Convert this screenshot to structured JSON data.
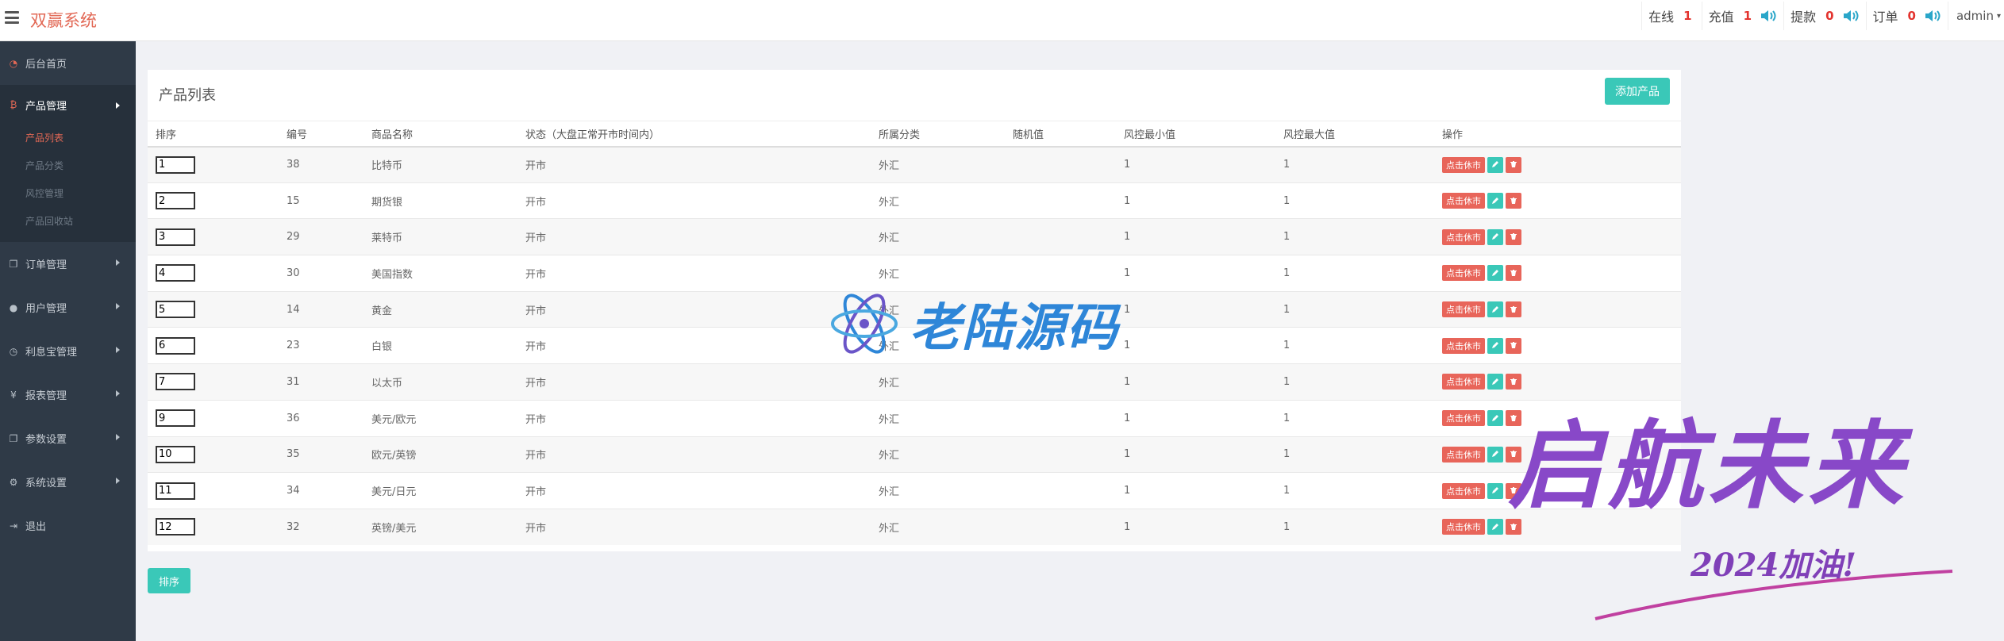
{
  "header": {
    "brand": "双赢系统",
    "online_label": "在线",
    "online_count": "1",
    "recharge_label": "充值",
    "recharge_count": "1",
    "withdraw_label": "提款",
    "withdraw_count": "0",
    "order_label": "订单",
    "order_count": "0",
    "user": "admin"
  },
  "sidebar": {
    "items": [
      {
        "label": "后台首页",
        "icon": "dashboard-icon"
      },
      {
        "label": "产品管理",
        "icon": "bitcoin-icon"
      },
      {
        "label": "订单管理",
        "icon": "copy-icon"
      },
      {
        "label": "用户管理",
        "icon": "user-icon"
      },
      {
        "label": "利息宝管理",
        "icon": "clock-icon"
      },
      {
        "label": "报表管理",
        "icon": "yen-icon"
      },
      {
        "label": "参数设置",
        "icon": "copy-icon"
      },
      {
        "label": "系统设置",
        "icon": "gears-icon"
      },
      {
        "label": "退出",
        "icon": "signout-icon"
      }
    ],
    "subitems": [
      "产品列表",
      "产品分类",
      "风控管理",
      "产品回收站"
    ]
  },
  "panel": {
    "title": "产品列表",
    "add_button": "添加产品",
    "sort_button": "排序"
  },
  "table": {
    "headers": [
      "排序",
      "编号",
      "商品名称",
      "状态（大盘正常开市时间内）",
      "所属分类",
      "随机值",
      "风控最小值",
      "风控最大值",
      "操作"
    ],
    "close_market_label": "点击休市",
    "rows": [
      {
        "sort": "1",
        "id": "38",
        "name": "比特币",
        "status": "开市",
        "category": "外汇",
        "random": "",
        "min": "1",
        "max": "1"
      },
      {
        "sort": "2",
        "id": "15",
        "name": "期货银",
        "status": "开市",
        "category": "外汇",
        "random": "",
        "min": "1",
        "max": "1"
      },
      {
        "sort": "3",
        "id": "29",
        "name": "莱特币",
        "status": "开市",
        "category": "外汇",
        "random": "",
        "min": "1",
        "max": "1"
      },
      {
        "sort": "4",
        "id": "30",
        "name": "美国指数",
        "status": "开市",
        "category": "外汇",
        "random": "",
        "min": "1",
        "max": "1"
      },
      {
        "sort": "5",
        "id": "14",
        "name": "黄金",
        "status": "开市",
        "category": "外汇",
        "random": "",
        "min": "1",
        "max": "1"
      },
      {
        "sort": "6",
        "id": "23",
        "name": "白银",
        "status": "开市",
        "category": "外汇",
        "random": "",
        "min": "1",
        "max": "1"
      },
      {
        "sort": "7",
        "id": "31",
        "name": "以太币",
        "status": "开市",
        "category": "外汇",
        "random": "",
        "min": "1",
        "max": "1"
      },
      {
        "sort": "9",
        "id": "36",
        "name": "美元/欧元",
        "status": "开市",
        "category": "外汇",
        "random": "",
        "min": "1",
        "max": "1"
      },
      {
        "sort": "10",
        "id": "35",
        "name": "欧元/英镑",
        "status": "开市",
        "category": "外汇",
        "random": "",
        "min": "1",
        "max": "1"
      },
      {
        "sort": "11",
        "id": "34",
        "name": "美元/日元",
        "status": "开市",
        "category": "外汇",
        "random": "",
        "min": "1",
        "max": "1"
      },
      {
        "sort": "12",
        "id": "32",
        "name": "英镑/美元",
        "status": "开市",
        "category": "外汇",
        "random": "",
        "min": "1",
        "max": "1"
      }
    ]
  },
  "watermarks": {
    "logo_text": "老陆源码",
    "brush_text": "启航未来",
    "brush_sub": "2024加油!"
  }
}
